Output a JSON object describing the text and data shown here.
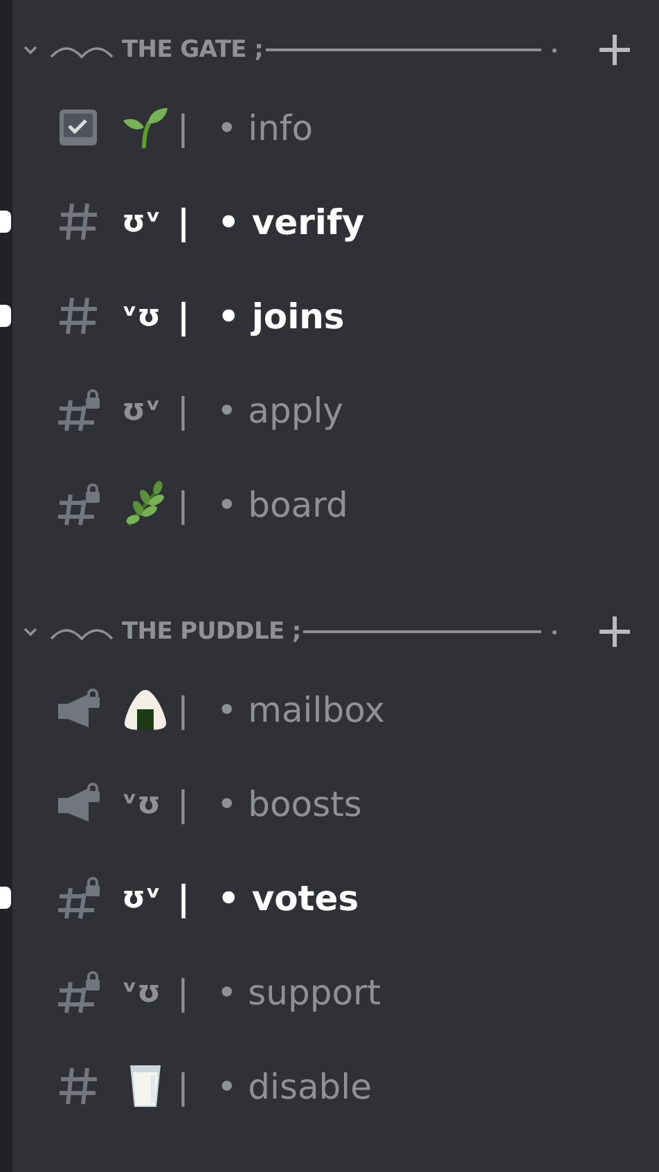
{
  "categories": [
    {
      "name": "THE GATE ;",
      "expanded": true,
      "channels": [
        {
          "kind": "rules",
          "deco": {
            "kind": "sprout"
          },
          "name": "• info",
          "unread": false
        },
        {
          "kind": "text",
          "deco": {
            "kind": "text",
            "text": "ʊᵛ"
          },
          "name": "• verify",
          "unread": true
        },
        {
          "kind": "text",
          "deco": {
            "kind": "text",
            "text": "ᵛʊ"
          },
          "name": "• joins",
          "unread": true
        },
        {
          "kind": "locked",
          "deco": {
            "kind": "text",
            "text": "ʊᵛ"
          },
          "name": "• apply",
          "unread": false
        },
        {
          "kind": "locked",
          "deco": {
            "kind": "herb"
          },
          "name": "• board",
          "unread": false
        }
      ]
    },
    {
      "name": "THE PUDDLE ;",
      "expanded": true,
      "channels": [
        {
          "kind": "announcement",
          "deco": {
            "kind": "riceball"
          },
          "name": "• mailbox",
          "unread": false
        },
        {
          "kind": "announcement",
          "deco": {
            "kind": "text",
            "text": "ᵛʊ"
          },
          "name": "• boosts",
          "unread": false
        },
        {
          "kind": "locked",
          "deco": {
            "kind": "text",
            "text": "ʊᵛ"
          },
          "name": "• votes",
          "unread": true
        },
        {
          "kind": "locked",
          "deco": {
            "kind": "text",
            "text": "ᵛʊ"
          },
          "name": "• support",
          "unread": false
        },
        {
          "kind": "text",
          "deco": {
            "kind": "milk"
          },
          "name": "• disable",
          "unread": false
        }
      ]
    }
  ],
  "separator": "|"
}
